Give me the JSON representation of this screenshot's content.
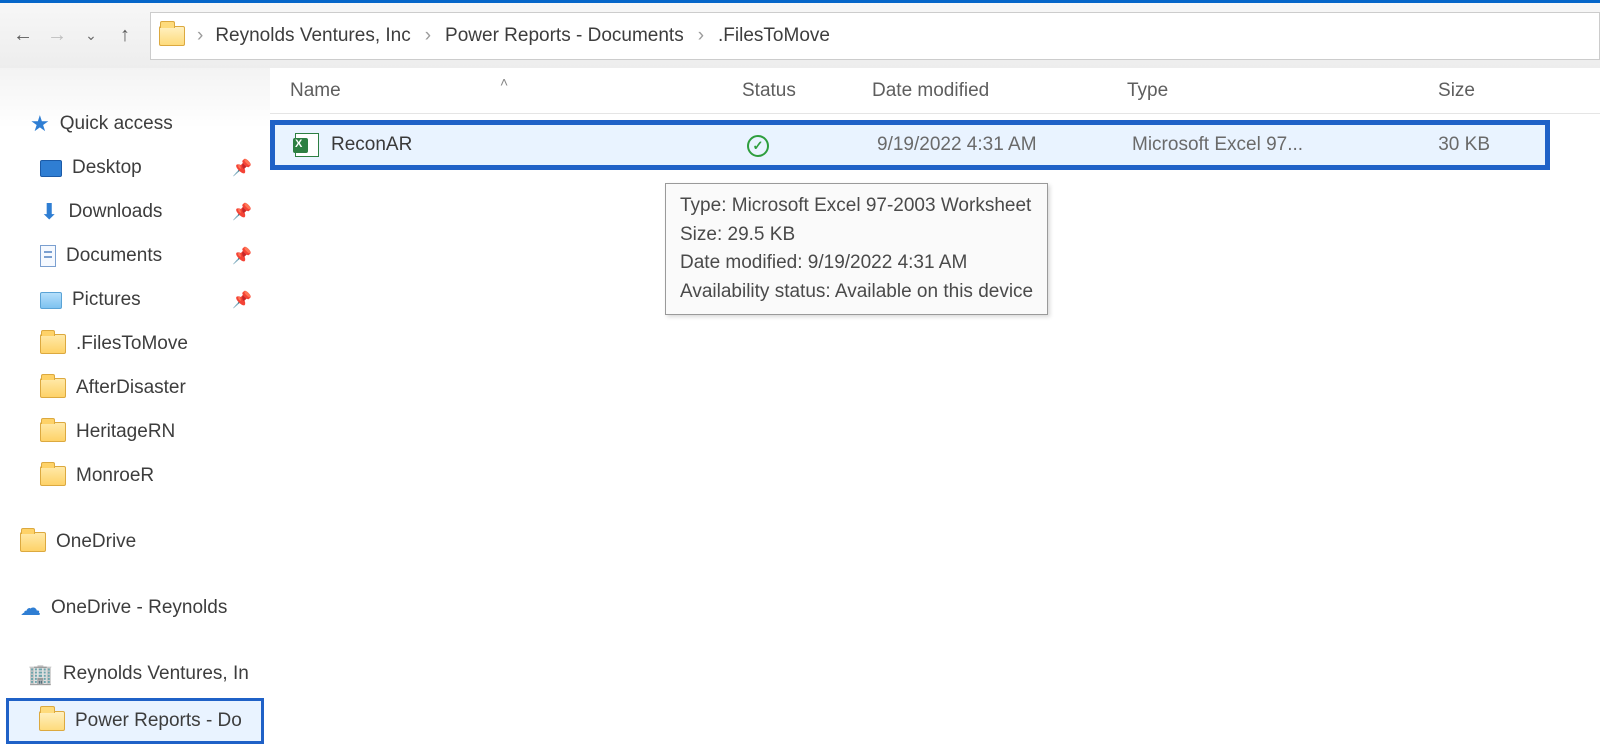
{
  "toolbar": {
    "back": "←",
    "forward": "→",
    "dropdown": "⌄",
    "up": "↑"
  },
  "breadcrumb": {
    "items": [
      "Reynolds Ventures, Inc",
      "Power Reports - Documents",
      ".FilesToMove"
    ],
    "sep": "›"
  },
  "sidebar": {
    "quick_access": "Quick access",
    "desktop": "Desktop",
    "downloads": "Downloads",
    "documents": "Documents",
    "pictures": "Pictures",
    "filestomove": ".FilesToMove",
    "afterdisaster": "AfterDisaster",
    "heritagern": "HeritageRN",
    "monroer": "MonroeR",
    "onedrive": "OneDrive",
    "onedrive_reynolds": "OneDrive - Reynolds",
    "reynolds_ventures": "Reynolds Ventures, In",
    "power_reports": "Power Reports - Do"
  },
  "columns": {
    "name": "Name",
    "status": "Status",
    "date": "Date modified",
    "type": "Type",
    "size": "Size"
  },
  "file": {
    "name": "ReconAR",
    "date": "9/19/2022 4:31 AM",
    "type": "Microsoft Excel 97...",
    "size": "30 KB",
    "status_check": "✓"
  },
  "tooltip": {
    "l1": "Type: Microsoft Excel 97-2003 Worksheet",
    "l2": "Size: 29.5 KB",
    "l3": "Date modified: 9/19/2022 4:31 AM",
    "l4": "Availability status: Available on this device"
  }
}
